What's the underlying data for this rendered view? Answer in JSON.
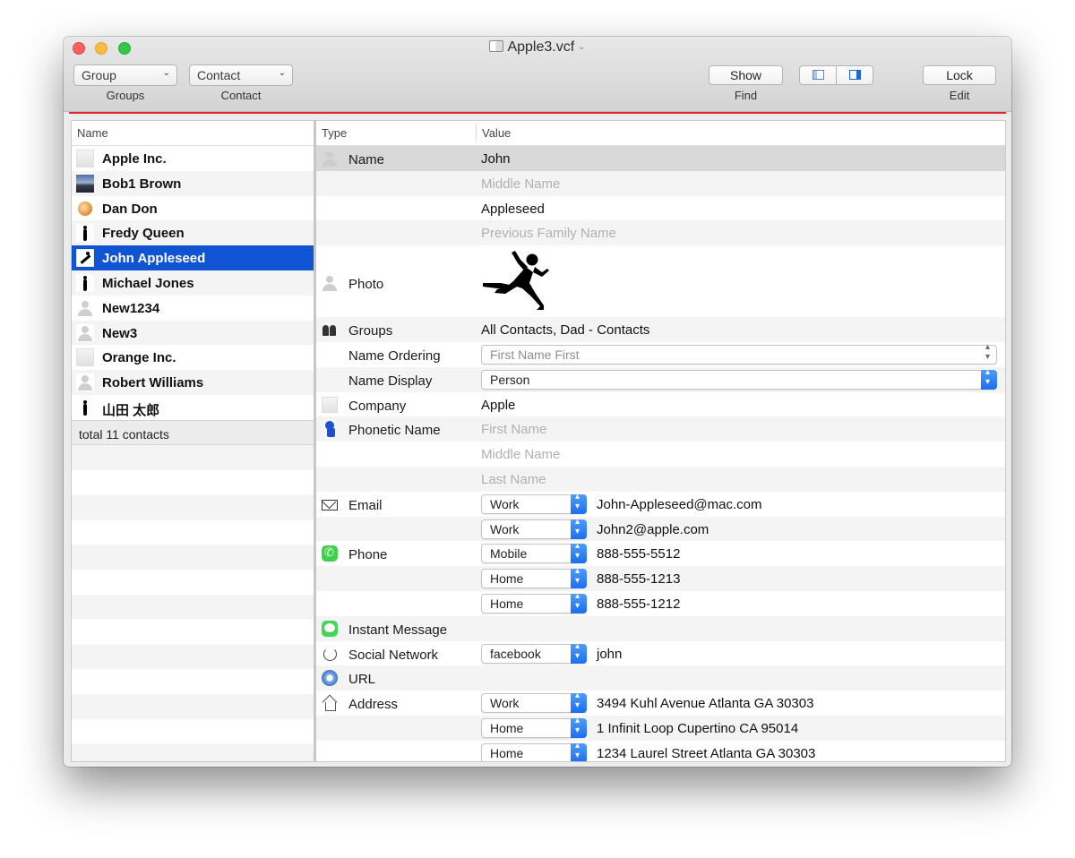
{
  "window": {
    "title": "Apple3.vcf",
    "toolbar": {
      "group_popup": "Group",
      "groups_caption": "Groups",
      "contact_popup": "Contact",
      "contact_caption": "Contact",
      "show_button": "Show",
      "find_caption": "Find",
      "lock_button": "Lock",
      "edit_caption": "Edit"
    },
    "accent_color": "#e8252b",
    "selection_color": "#1054d4"
  },
  "contacts": {
    "header": "Name",
    "items": [
      {
        "label": "Apple Inc.",
        "icon": "building-icon"
      },
      {
        "label": "Bob1 Brown",
        "icon": "photo-avatar"
      },
      {
        "label": "Dan Don",
        "icon": "orange-avatar"
      },
      {
        "label": "Fredy Queen",
        "icon": "silhouette-avatar"
      },
      {
        "label": "John Appleseed",
        "icon": "jumper-avatar"
      },
      {
        "label": "Michael Jones",
        "icon": "silhouette-avatar"
      },
      {
        "label": "New1234",
        "icon": "person-icon"
      },
      {
        "label": "New3",
        "icon": "person-icon"
      },
      {
        "label": "Orange Inc.",
        "icon": "building-icon"
      },
      {
        "label": "Robert Williams",
        "icon": "person-icon"
      },
      {
        "label": "山田 太郎",
        "icon": "silhouette-avatar"
      }
    ],
    "selected": "John Appleseed",
    "footer": "total 11 contacts"
  },
  "detail": {
    "type_header": "Type",
    "value_header": "Value",
    "name": {
      "type": "Name",
      "first": "John",
      "middle_placeholder": "Middle Name",
      "last": "Appleseed",
      "previous_placeholder": "Previous Family Name"
    },
    "photo": {
      "type": "Photo"
    },
    "groups": {
      "type": "Groups",
      "value": "All Contacts, Dad - Contacts"
    },
    "name_ordering": {
      "type": "Name Ordering",
      "value": "First Name First"
    },
    "name_display": {
      "type": "Name Display",
      "value": "Person"
    },
    "company": {
      "type": "Company",
      "value": "Apple"
    },
    "phonetic": {
      "type": "Phonetic Name",
      "first_placeholder": "First Name",
      "middle_placeholder": "Middle Name",
      "last_placeholder": "Last Name"
    },
    "email": {
      "type": "Email",
      "entries": [
        {
          "label": "Work",
          "value": "John-Appleseed@mac.com"
        },
        {
          "label": "Work",
          "value": "John2@apple.com"
        }
      ]
    },
    "phone": {
      "type": "Phone",
      "entries": [
        {
          "label": "Mobile",
          "value": "888-555-5512"
        },
        {
          "label": "Home",
          "value": "888-555-1213"
        },
        {
          "label": "Home",
          "value": "888-555-1212"
        }
      ]
    },
    "instant_message": {
      "type": "Instant Message"
    },
    "social": {
      "type": "Social Network",
      "entries": [
        {
          "label": "facebook",
          "value": "john"
        }
      ]
    },
    "url": {
      "type": "URL"
    },
    "address": {
      "type": "Address",
      "entries": [
        {
          "label": "Work",
          "value": "3494 Kuhl Avenue Atlanta GA 30303"
        },
        {
          "label": "Home",
          "value": "1 Infinit Loop Cupertino CA 95014"
        },
        {
          "label": "Home",
          "value": "1234 Laurel Street Atlanta GA 30303"
        }
      ]
    }
  }
}
